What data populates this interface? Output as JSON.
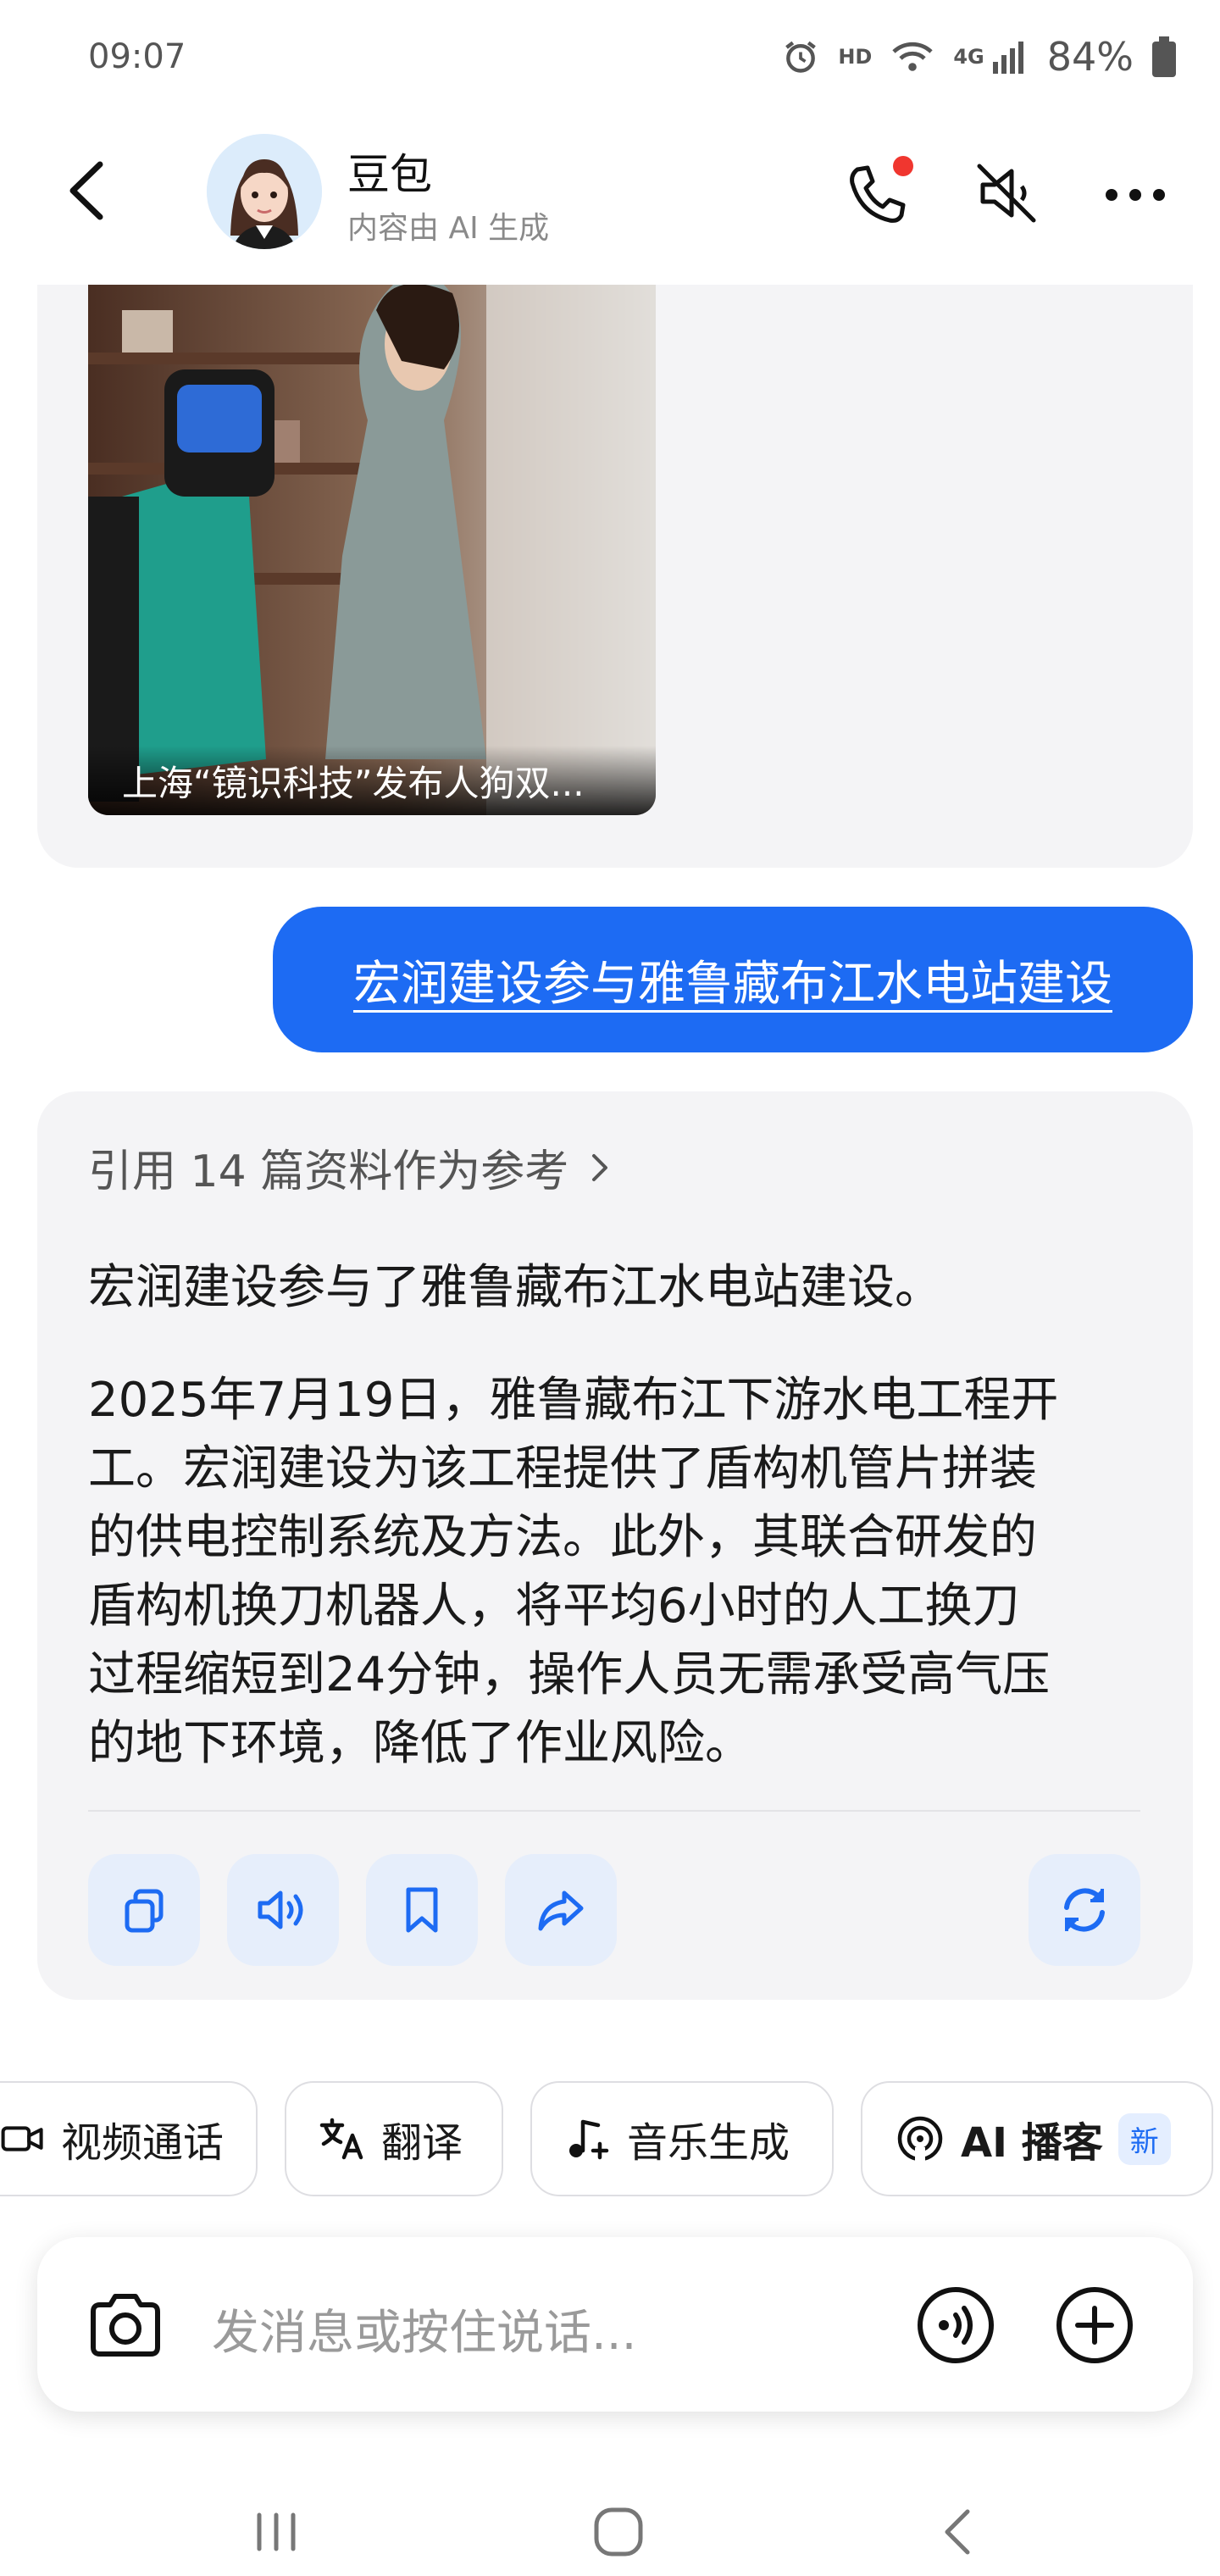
{
  "status_bar": {
    "time": "09:07",
    "hd": "HD",
    "network": "4G",
    "battery": "84%"
  },
  "header": {
    "name": "豆包",
    "subtitle": "内容由 AI 生成"
  },
  "news_card": {
    "caption": "上海“镜识科技”发布人狗双..."
  },
  "user_message": "宏润建设参与雅鲁藏布江水电站建设",
  "answer": {
    "reference": "引用 14 篇资料作为参考",
    "lead": "宏润建设参与了雅鲁藏布江水电站建设。",
    "body_lines": [
      "2025年7月19日，雅鲁藏布江下游水电工程开",
      "工。宏润建设为该工程提供了盾构机管片拼装",
      "的供电控制系统及方法。此外，其联合研发的",
      "盾构机换刀机器人，将平均6小时的人工换刀",
      "过程缩短到24分钟，操作人员无需承受高气压",
      "的地下环境，降低了作业风险。"
    ]
  },
  "actions": [
    "copy-icon",
    "speaker-icon",
    "bookmark-icon",
    "share-icon",
    "refresh-icon"
  ],
  "chips": {
    "video_call": "视频通话",
    "translate": "翻译",
    "music": "音乐生成",
    "podcast": "AI 播客",
    "podcast_badge": "新"
  },
  "input": {
    "placeholder": "发消息或按住说话..."
  },
  "colors": {
    "accent": "#1d6bf3",
    "card_bg": "#f4f4f6",
    "action_bg": "#e6eefb"
  }
}
